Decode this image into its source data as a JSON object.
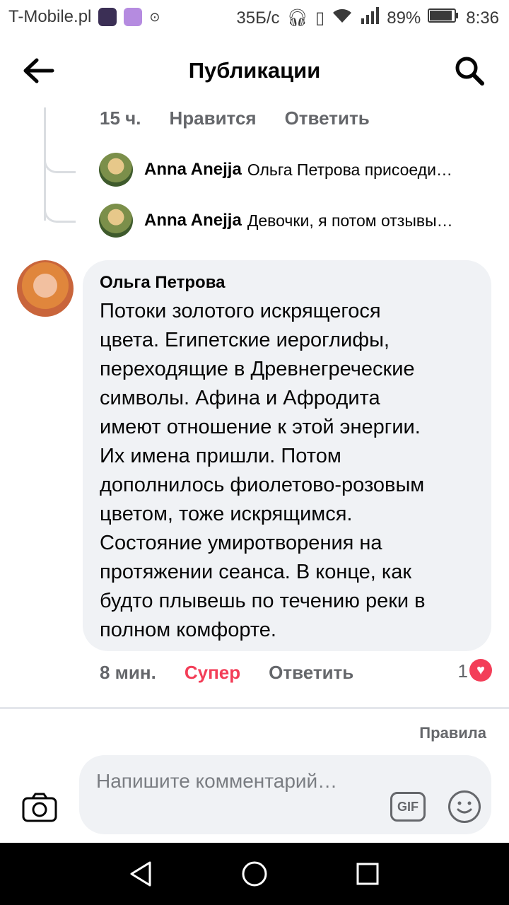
{
  "status_bar": {
    "carrier": "T-Mobile.pl",
    "speed": "35Б/с",
    "battery": "89%",
    "time": "8:36"
  },
  "header": {
    "title": "Публикации"
  },
  "parent_meta": {
    "time": "15 ч.",
    "like": "Нравится",
    "reply": "Ответить"
  },
  "replies": [
    {
      "author": "Anna Anejja",
      "text": "Ольга Петрова присоеди…"
    },
    {
      "author": "Anna Anejja",
      "text": "Девочки, я потом отзывы…"
    }
  ],
  "comment": {
    "author": "Ольга Петрова",
    "text": "Потоки золотого искрящегося\nцвета. Египетские иероглифы,\nпереходящие в Древнегреческие\nсимволы. Афина и Афродита\nимеют отношение к этой энергии.\nИх имена пришли. Потом\nдополнилось фиолетово-розовым\nцветом, тоже искрящимся.\nСостояние умиротворения на\nпротяжении сеанса. В конце, как\nбудто плывешь по   течению реки в\nполном комфорте.",
    "time": "8 мин.",
    "reaction": "Супер",
    "reply": "Ответить",
    "reaction_count": "1"
  },
  "rules_link": "Правила",
  "composer": {
    "placeholder": "Напишите комментарий…",
    "gif_label": "GIF"
  },
  "colors": {
    "accent_reaction": "#f33e58",
    "bubble": "#f0f2f5",
    "secondary_text": "#65676b"
  }
}
